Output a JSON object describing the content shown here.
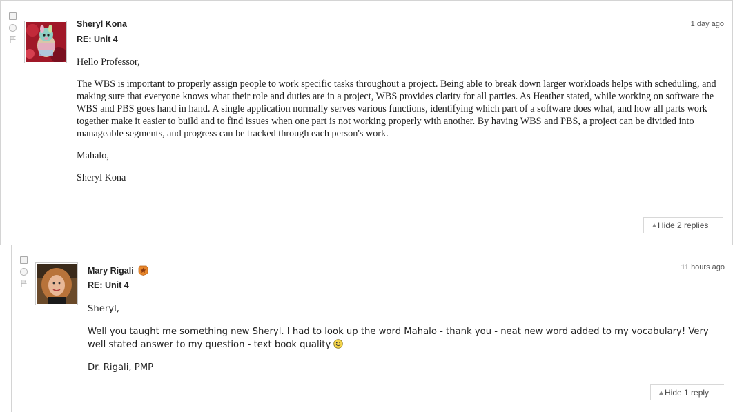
{
  "posts": [
    {
      "author": "Sheryl Kona",
      "subject": "RE: Unit 4",
      "timestamp": "1 day ago",
      "body": [
        "Hello Professor,",
        "The WBS is important to properly assign people to work specific tasks throughout a project. Being able to break down larger workloads helps with scheduling, and making sure that everyone knows what their role and duties are in a project, WBS provides clarity for all parties. As Heather stated, while working on software the WBS and PBS goes hand in hand. A single application normally serves various functions, identifying which part of a software does what, and how all parts work together make it easier to build and to find issues when one part is not working properly with another. By having WBS and PBS, a project can be divided into manageable segments, and progress can be tracked through each person's work.",
        "Mahalo,",
        "Sheryl Kona"
      ],
      "toggle_label": "Hide 2 replies"
    },
    {
      "author": "Mary Rigali",
      "subject": "RE: Unit 4",
      "timestamp": "11 hours ago",
      "body": [
        "Sheryl,",
        "Well you taught me something new Sheryl. I had to look up the word Mahalo - thank you -  neat new word added to my vocabulary! Very well stated answer to my question - text book quality",
        "Dr. Rigali, PMP"
      ],
      "toggle_label": "Hide 1 reply"
    }
  ],
  "icons": {
    "toggle_arrow": "▲",
    "badge": "instructor-badge-icon",
    "smiley": "smiley-icon"
  },
  "colors": {
    "border": "#d4d4d4",
    "badge": "#e8872b",
    "text": "#222222"
  }
}
